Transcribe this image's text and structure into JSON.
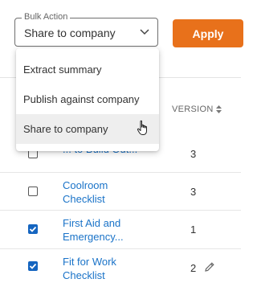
{
  "bulk_action": {
    "legend": "Bulk Action",
    "selected": "Share to company",
    "apply_label": "Apply",
    "options": [
      "Extract summary",
      "Publish against company",
      "Share to company"
    ]
  },
  "table": {
    "version_header": "VERSION",
    "rows": [
      {
        "title": "... to Build Out...",
        "version": "3",
        "checked": false
      },
      {
        "title": "Coolroom Checklist",
        "version": "3",
        "checked": false
      },
      {
        "title": "First Aid and Emergency...",
        "version": "1",
        "checked": true
      },
      {
        "title": "Fit for Work Checklist",
        "version": "2",
        "checked": true
      }
    ]
  },
  "colors": {
    "accent": "#e8711b",
    "link": "#1a73c8",
    "checkbox": "#1565c0"
  },
  "icons": [
    "chevron-down-icon",
    "sort-icon",
    "checkmark-icon",
    "pencil-icon",
    "hand-cursor-icon"
  ]
}
